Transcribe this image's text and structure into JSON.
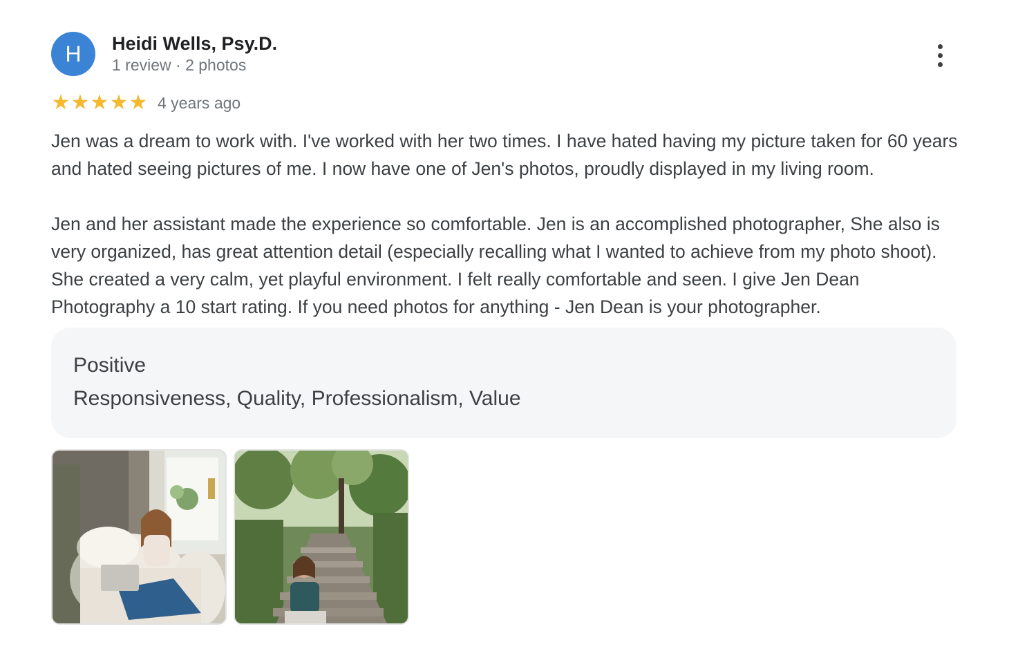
{
  "reviewer": {
    "initial": "H",
    "name": "Heidi Wells, Psy.D.",
    "meta": "1 review · 2 photos",
    "avatar_color": "#3a83d5"
  },
  "rating": {
    "stars": 5,
    "max": 5,
    "star_glyph": "★",
    "star_color": "#f5b82e",
    "time": "4 years ago"
  },
  "review_text": {
    "paragraph_1": "Jen was a dream to work with. I've worked with her two times. I have hated having my picture taken for 60 years and hated seeing pictures of me. I now have one of Jen's photos, proudly displayed in my living room.",
    "paragraph_2": "Jen and her assistant made the experience so comfortable. Jen is an accomplished photographer, She also is very organized, has great attention detail (especially recalling what I wanted to achieve from my photo shoot). She created a very calm, yet playful environment. I felt really comfortable and seen. I give Jen Dean Photography a 10 start rating. If you need photos for anything - Jen Dean is your photographer."
  },
  "attributes": {
    "label": "Positive",
    "values": "Responsiveness, Quality, Professionalism, Value"
  },
  "photos": [
    {
      "icon": "photo-woman-armchair-laptop"
    },
    {
      "icon": "photo-woman-stone-steps-forest"
    }
  ],
  "menu": {
    "icon": "more-vert-icon"
  }
}
